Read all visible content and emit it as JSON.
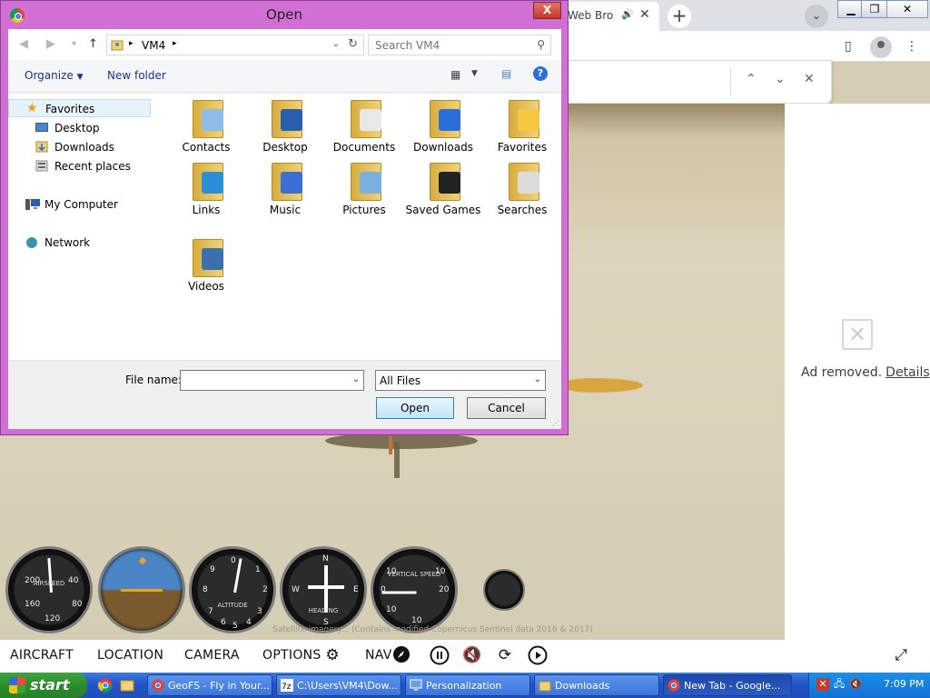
{
  "browser": {
    "tab_title": "Web Bro",
    "search_tabs_icon": "chevron-down-icon"
  },
  "ad": {
    "text": "Ad removed.",
    "link": "Details"
  },
  "credits": "Satellite imagery... (Contains modified Copernicus Sentinel data 2016 & 2017)",
  "gamebar": {
    "aircraft": "AIRCRAFT",
    "location": "LOCATION",
    "camera": "CAMERA",
    "options": "OPTIONS",
    "nav": "NAV"
  },
  "gauges": {
    "airspeed_label": "AIRSPEED",
    "altimeter_label": "ALTITUDE",
    "heading_label": "HEADING",
    "vsi_label": "VERTICAL SPEED"
  },
  "dialog": {
    "title": "Open",
    "close_label": "X",
    "breadcrumb": "VM4",
    "search_placeholder": "Search VM4",
    "organize": "Organize",
    "new_folder": "New folder",
    "nav": {
      "favorites": "Favorites",
      "desktop": "Desktop",
      "downloads": "Downloads",
      "recent": "Recent places",
      "computer": "My Computer",
      "network": "Network"
    },
    "folders": [
      "Contacts",
      "Desktop",
      "Documents",
      "Downloads",
      "Favorites",
      "Links",
      "Music",
      "Pictures",
      "Saved Games",
      "Searches",
      "Videos"
    ],
    "file_name_label": "File name:",
    "file_name_value": "",
    "file_type": "All Files",
    "open_button": "Open",
    "cancel_button": "Cancel"
  },
  "taskbar": {
    "start": "start",
    "tasks": [
      "GeoFS - Fly in Your...",
      "C:\\Users\\VM4\\Dow...",
      "Personalization",
      "Downloads",
      "New Tab - Google..."
    ],
    "clock": "7:09 PM"
  },
  "colors": {
    "dialog_frame": "#d16fd4",
    "taskbar": "#2354c8",
    "start_green": "#3fa43f",
    "folder_yellow": "#f1d27a"
  }
}
